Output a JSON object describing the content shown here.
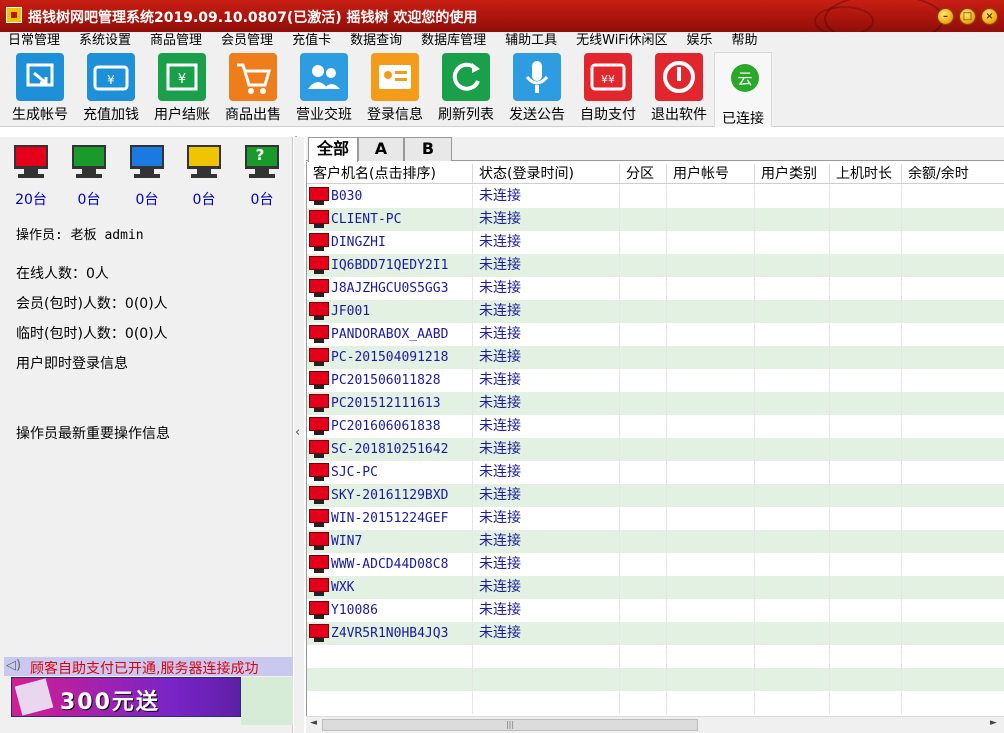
{
  "window": {
    "title": "摇钱树网吧管理系统2019.09.10.0807(已激活) 摇钱树 欢迎您的使用",
    "buttons": {
      "minimize": "–",
      "maximize": "□",
      "close": "×"
    }
  },
  "menu": [
    "日常管理",
    "系统设置",
    "商品管理",
    "会员管理",
    "充值卡",
    "数据查询",
    "数据库管理",
    "辅助工具",
    "无线WiFi休闲区",
    "娱乐",
    "帮助"
  ],
  "toolbar": [
    {
      "label": "生成帐号",
      "icon": "generate-account-icon",
      "color": "#1e90d8"
    },
    {
      "label": "充值加钱",
      "icon": "recharge-icon",
      "color": "#1e90d8"
    },
    {
      "label": "用户结账",
      "icon": "checkout-icon",
      "color": "#1aa04a"
    },
    {
      "label": "商品出售",
      "icon": "shopping-cart-icon",
      "color": "#f07d1c"
    },
    {
      "label": "营业交班",
      "icon": "users-handover-icon",
      "color": "#2d9ce0"
    },
    {
      "label": "登录信息",
      "icon": "login-info-icon",
      "color": "#f39c1a"
    },
    {
      "label": "刷新列表",
      "icon": "refresh-icon",
      "color": "#1aa04a"
    },
    {
      "label": "发送公告",
      "icon": "microphone-icon",
      "color": "#2d9ce0"
    },
    {
      "label": "自助支付",
      "icon": "self-pay-icon",
      "color": "#e2262e"
    },
    {
      "label": "退出软件",
      "icon": "power-icon",
      "color": "#e2262e"
    },
    {
      "label": "已连接",
      "icon": "cloud-connected-icon",
      "glyph": "云",
      "color": "#2aa82a"
    }
  ],
  "left": {
    "monitor_counts": [
      {
        "color": "#e4001a",
        "count": "20台",
        "glyph": ""
      },
      {
        "color": "#1a9a2a",
        "count": "0台",
        "glyph": ""
      },
      {
        "color": "#1a7ae0",
        "count": "0台",
        "glyph": ""
      },
      {
        "color": "#f0c400",
        "count": "0台",
        "glyph": ""
      },
      {
        "color": "#1a9a2a",
        "count": "0台",
        "glyph": "?"
      }
    ],
    "operator": "操作员:  老板 admin",
    "online": "在线人数：0人",
    "member": "会员(包时)人数：0(0)人",
    "temp": "临时(包时)人数：0(0)人",
    "login_info": "用户即时登录信息",
    "op_info": "操作员最新重要操作信息",
    "notice": "顾客自助支付已开通,服务器连接成功",
    "ad": "300元送"
  },
  "tabs": [
    "全部",
    "A",
    "B"
  ],
  "table": {
    "columns": [
      "客户机名(点击排序)",
      "状态(登录时间)",
      "分区",
      "用户帐号",
      "用户类别",
      "上机时长",
      "余额/余时"
    ],
    "rows": [
      [
        "B030",
        "未连接"
      ],
      [
        "CLIENT-PC",
        "未连接"
      ],
      [
        "DINGZHI",
        "未连接"
      ],
      [
        "IQ6BDD71QEDY2I1",
        "未连接"
      ],
      [
        "J8AJZHGCU0S5GG3",
        "未连接"
      ],
      [
        "JF001",
        "未连接"
      ],
      [
        "PANDORABOX_AABD",
        "未连接"
      ],
      [
        "PC-201504091218",
        "未连接"
      ],
      [
        "PC201506011828",
        "未连接"
      ],
      [
        "PC201512111613",
        "未连接"
      ],
      [
        "PC201606061838",
        "未连接"
      ],
      [
        "SC-201810251642",
        "未连接"
      ],
      [
        "SJC-PC",
        "未连接"
      ],
      [
        "SKY-20161129BXD",
        "未连接"
      ],
      [
        "WIN-20151224GEF",
        "未连接"
      ],
      [
        "WIN7",
        "未连接"
      ],
      [
        "WWW-ADCD44D08C8",
        "未连接"
      ],
      [
        "WXK",
        "未连接"
      ],
      [
        "Y10086",
        "未连接"
      ],
      [
        "Z4VR5R1N0HB4JQ3",
        "未连接"
      ]
    ],
    "blank_rows": 3
  },
  "scrollbar": {
    "left": "◄",
    "right": "►",
    "grip": "|||"
  }
}
